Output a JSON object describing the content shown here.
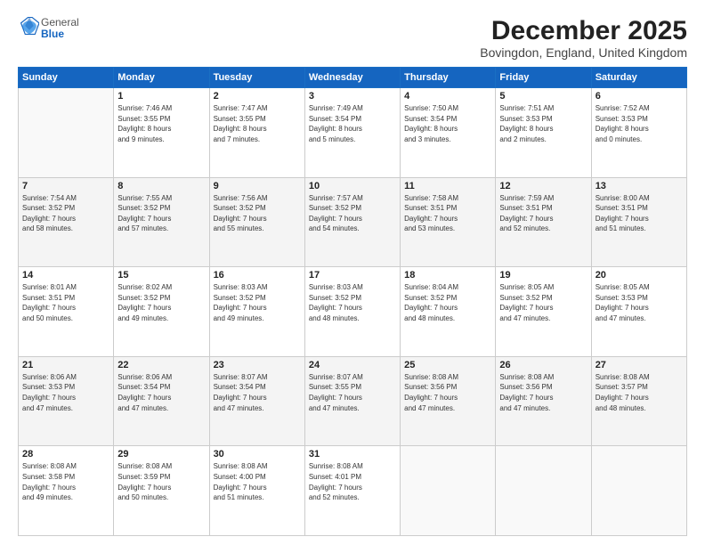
{
  "logo": {
    "general": "General",
    "blue": "Blue"
  },
  "header": {
    "title": "December 2025",
    "subtitle": "Bovingdon, England, United Kingdom"
  },
  "weekdays": [
    "Sunday",
    "Monday",
    "Tuesday",
    "Wednesday",
    "Thursday",
    "Friday",
    "Saturday"
  ],
  "weeks": [
    [
      {
        "day": "",
        "info": ""
      },
      {
        "day": "1",
        "info": "Sunrise: 7:46 AM\nSunset: 3:55 PM\nDaylight: 8 hours\nand 9 minutes."
      },
      {
        "day": "2",
        "info": "Sunrise: 7:47 AM\nSunset: 3:55 PM\nDaylight: 8 hours\nand 7 minutes."
      },
      {
        "day": "3",
        "info": "Sunrise: 7:49 AM\nSunset: 3:54 PM\nDaylight: 8 hours\nand 5 minutes."
      },
      {
        "day": "4",
        "info": "Sunrise: 7:50 AM\nSunset: 3:54 PM\nDaylight: 8 hours\nand 3 minutes."
      },
      {
        "day": "5",
        "info": "Sunrise: 7:51 AM\nSunset: 3:53 PM\nDaylight: 8 hours\nand 2 minutes."
      },
      {
        "day": "6",
        "info": "Sunrise: 7:52 AM\nSunset: 3:53 PM\nDaylight: 8 hours\nand 0 minutes."
      }
    ],
    [
      {
        "day": "7",
        "info": "Sunrise: 7:54 AM\nSunset: 3:52 PM\nDaylight: 7 hours\nand 58 minutes."
      },
      {
        "day": "8",
        "info": "Sunrise: 7:55 AM\nSunset: 3:52 PM\nDaylight: 7 hours\nand 57 minutes."
      },
      {
        "day": "9",
        "info": "Sunrise: 7:56 AM\nSunset: 3:52 PM\nDaylight: 7 hours\nand 55 minutes."
      },
      {
        "day": "10",
        "info": "Sunrise: 7:57 AM\nSunset: 3:52 PM\nDaylight: 7 hours\nand 54 minutes."
      },
      {
        "day": "11",
        "info": "Sunrise: 7:58 AM\nSunset: 3:51 PM\nDaylight: 7 hours\nand 53 minutes."
      },
      {
        "day": "12",
        "info": "Sunrise: 7:59 AM\nSunset: 3:51 PM\nDaylight: 7 hours\nand 52 minutes."
      },
      {
        "day": "13",
        "info": "Sunrise: 8:00 AM\nSunset: 3:51 PM\nDaylight: 7 hours\nand 51 minutes."
      }
    ],
    [
      {
        "day": "14",
        "info": "Sunrise: 8:01 AM\nSunset: 3:51 PM\nDaylight: 7 hours\nand 50 minutes."
      },
      {
        "day": "15",
        "info": "Sunrise: 8:02 AM\nSunset: 3:52 PM\nDaylight: 7 hours\nand 49 minutes."
      },
      {
        "day": "16",
        "info": "Sunrise: 8:03 AM\nSunset: 3:52 PM\nDaylight: 7 hours\nand 49 minutes."
      },
      {
        "day": "17",
        "info": "Sunrise: 8:03 AM\nSunset: 3:52 PM\nDaylight: 7 hours\nand 48 minutes."
      },
      {
        "day": "18",
        "info": "Sunrise: 8:04 AM\nSunset: 3:52 PM\nDaylight: 7 hours\nand 48 minutes."
      },
      {
        "day": "19",
        "info": "Sunrise: 8:05 AM\nSunset: 3:52 PM\nDaylight: 7 hours\nand 47 minutes."
      },
      {
        "day": "20",
        "info": "Sunrise: 8:05 AM\nSunset: 3:53 PM\nDaylight: 7 hours\nand 47 minutes."
      }
    ],
    [
      {
        "day": "21",
        "info": "Sunrise: 8:06 AM\nSunset: 3:53 PM\nDaylight: 7 hours\nand 47 minutes."
      },
      {
        "day": "22",
        "info": "Sunrise: 8:06 AM\nSunset: 3:54 PM\nDaylight: 7 hours\nand 47 minutes."
      },
      {
        "day": "23",
        "info": "Sunrise: 8:07 AM\nSunset: 3:54 PM\nDaylight: 7 hours\nand 47 minutes."
      },
      {
        "day": "24",
        "info": "Sunrise: 8:07 AM\nSunset: 3:55 PM\nDaylight: 7 hours\nand 47 minutes."
      },
      {
        "day": "25",
        "info": "Sunrise: 8:08 AM\nSunset: 3:56 PM\nDaylight: 7 hours\nand 47 minutes."
      },
      {
        "day": "26",
        "info": "Sunrise: 8:08 AM\nSunset: 3:56 PM\nDaylight: 7 hours\nand 47 minutes."
      },
      {
        "day": "27",
        "info": "Sunrise: 8:08 AM\nSunset: 3:57 PM\nDaylight: 7 hours\nand 48 minutes."
      }
    ],
    [
      {
        "day": "28",
        "info": "Sunrise: 8:08 AM\nSunset: 3:58 PM\nDaylight: 7 hours\nand 49 minutes."
      },
      {
        "day": "29",
        "info": "Sunrise: 8:08 AM\nSunset: 3:59 PM\nDaylight: 7 hours\nand 50 minutes."
      },
      {
        "day": "30",
        "info": "Sunrise: 8:08 AM\nSunset: 4:00 PM\nDaylight: 7 hours\nand 51 minutes."
      },
      {
        "day": "31",
        "info": "Sunrise: 8:08 AM\nSunset: 4:01 PM\nDaylight: 7 hours\nand 52 minutes."
      },
      {
        "day": "",
        "info": ""
      },
      {
        "day": "",
        "info": ""
      },
      {
        "day": "",
        "info": ""
      }
    ]
  ]
}
